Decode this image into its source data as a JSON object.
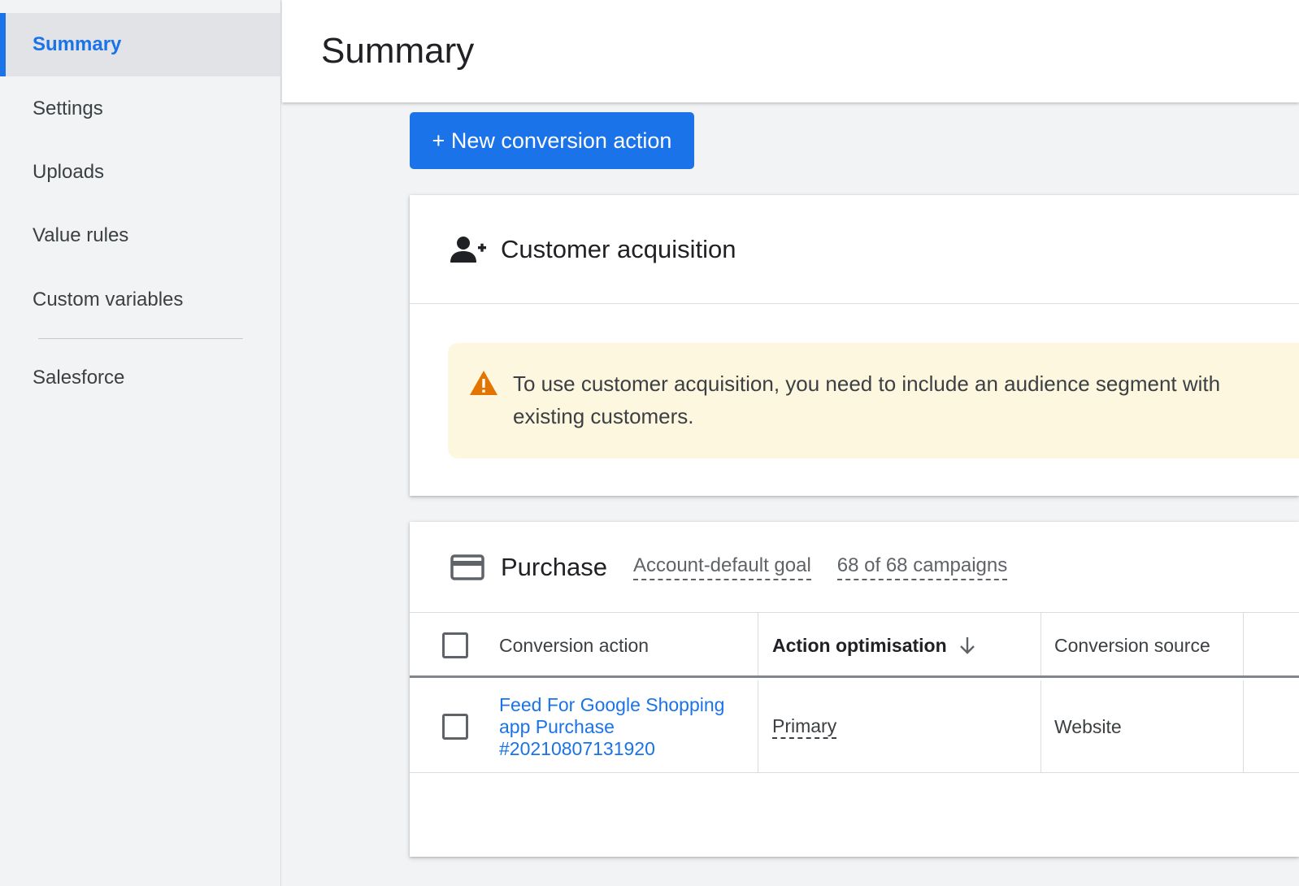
{
  "sidebar": {
    "items": [
      {
        "label": "Summary",
        "active": true
      },
      {
        "label": "Settings"
      },
      {
        "label": "Uploads"
      },
      {
        "label": "Value rules"
      },
      {
        "label": "Custom variables"
      }
    ],
    "extra_item": "Salesforce"
  },
  "header": {
    "title": "Summary"
  },
  "new_button": {
    "label": "+ New conversion action"
  },
  "acquisition": {
    "title": "Customer acquisition",
    "icon": "person-add-icon",
    "warning_icon": "warning-icon",
    "warning_line1": "To use customer acquisition, you need to include an audience segment with",
    "warning_line2": "existing customers."
  },
  "purchase": {
    "title": "Purchase",
    "icon": "credit-card-icon",
    "goal_link": "Account-default goal",
    "campaigns_link": "68 of 68 campaigns",
    "columns": [
      "Conversion action",
      "Action optimisation",
      "Conversion source"
    ],
    "sort_icon": "arrow-down-icon",
    "rows": [
      {
        "action": "Feed For Google Shopping app Purchase #20210807131920",
        "optimisation": "Primary",
        "source": "Website"
      }
    ]
  },
  "colors": {
    "accent": "#1a73e8",
    "warning_bg": "#fef7e0",
    "warning_icon": "#e37400"
  }
}
